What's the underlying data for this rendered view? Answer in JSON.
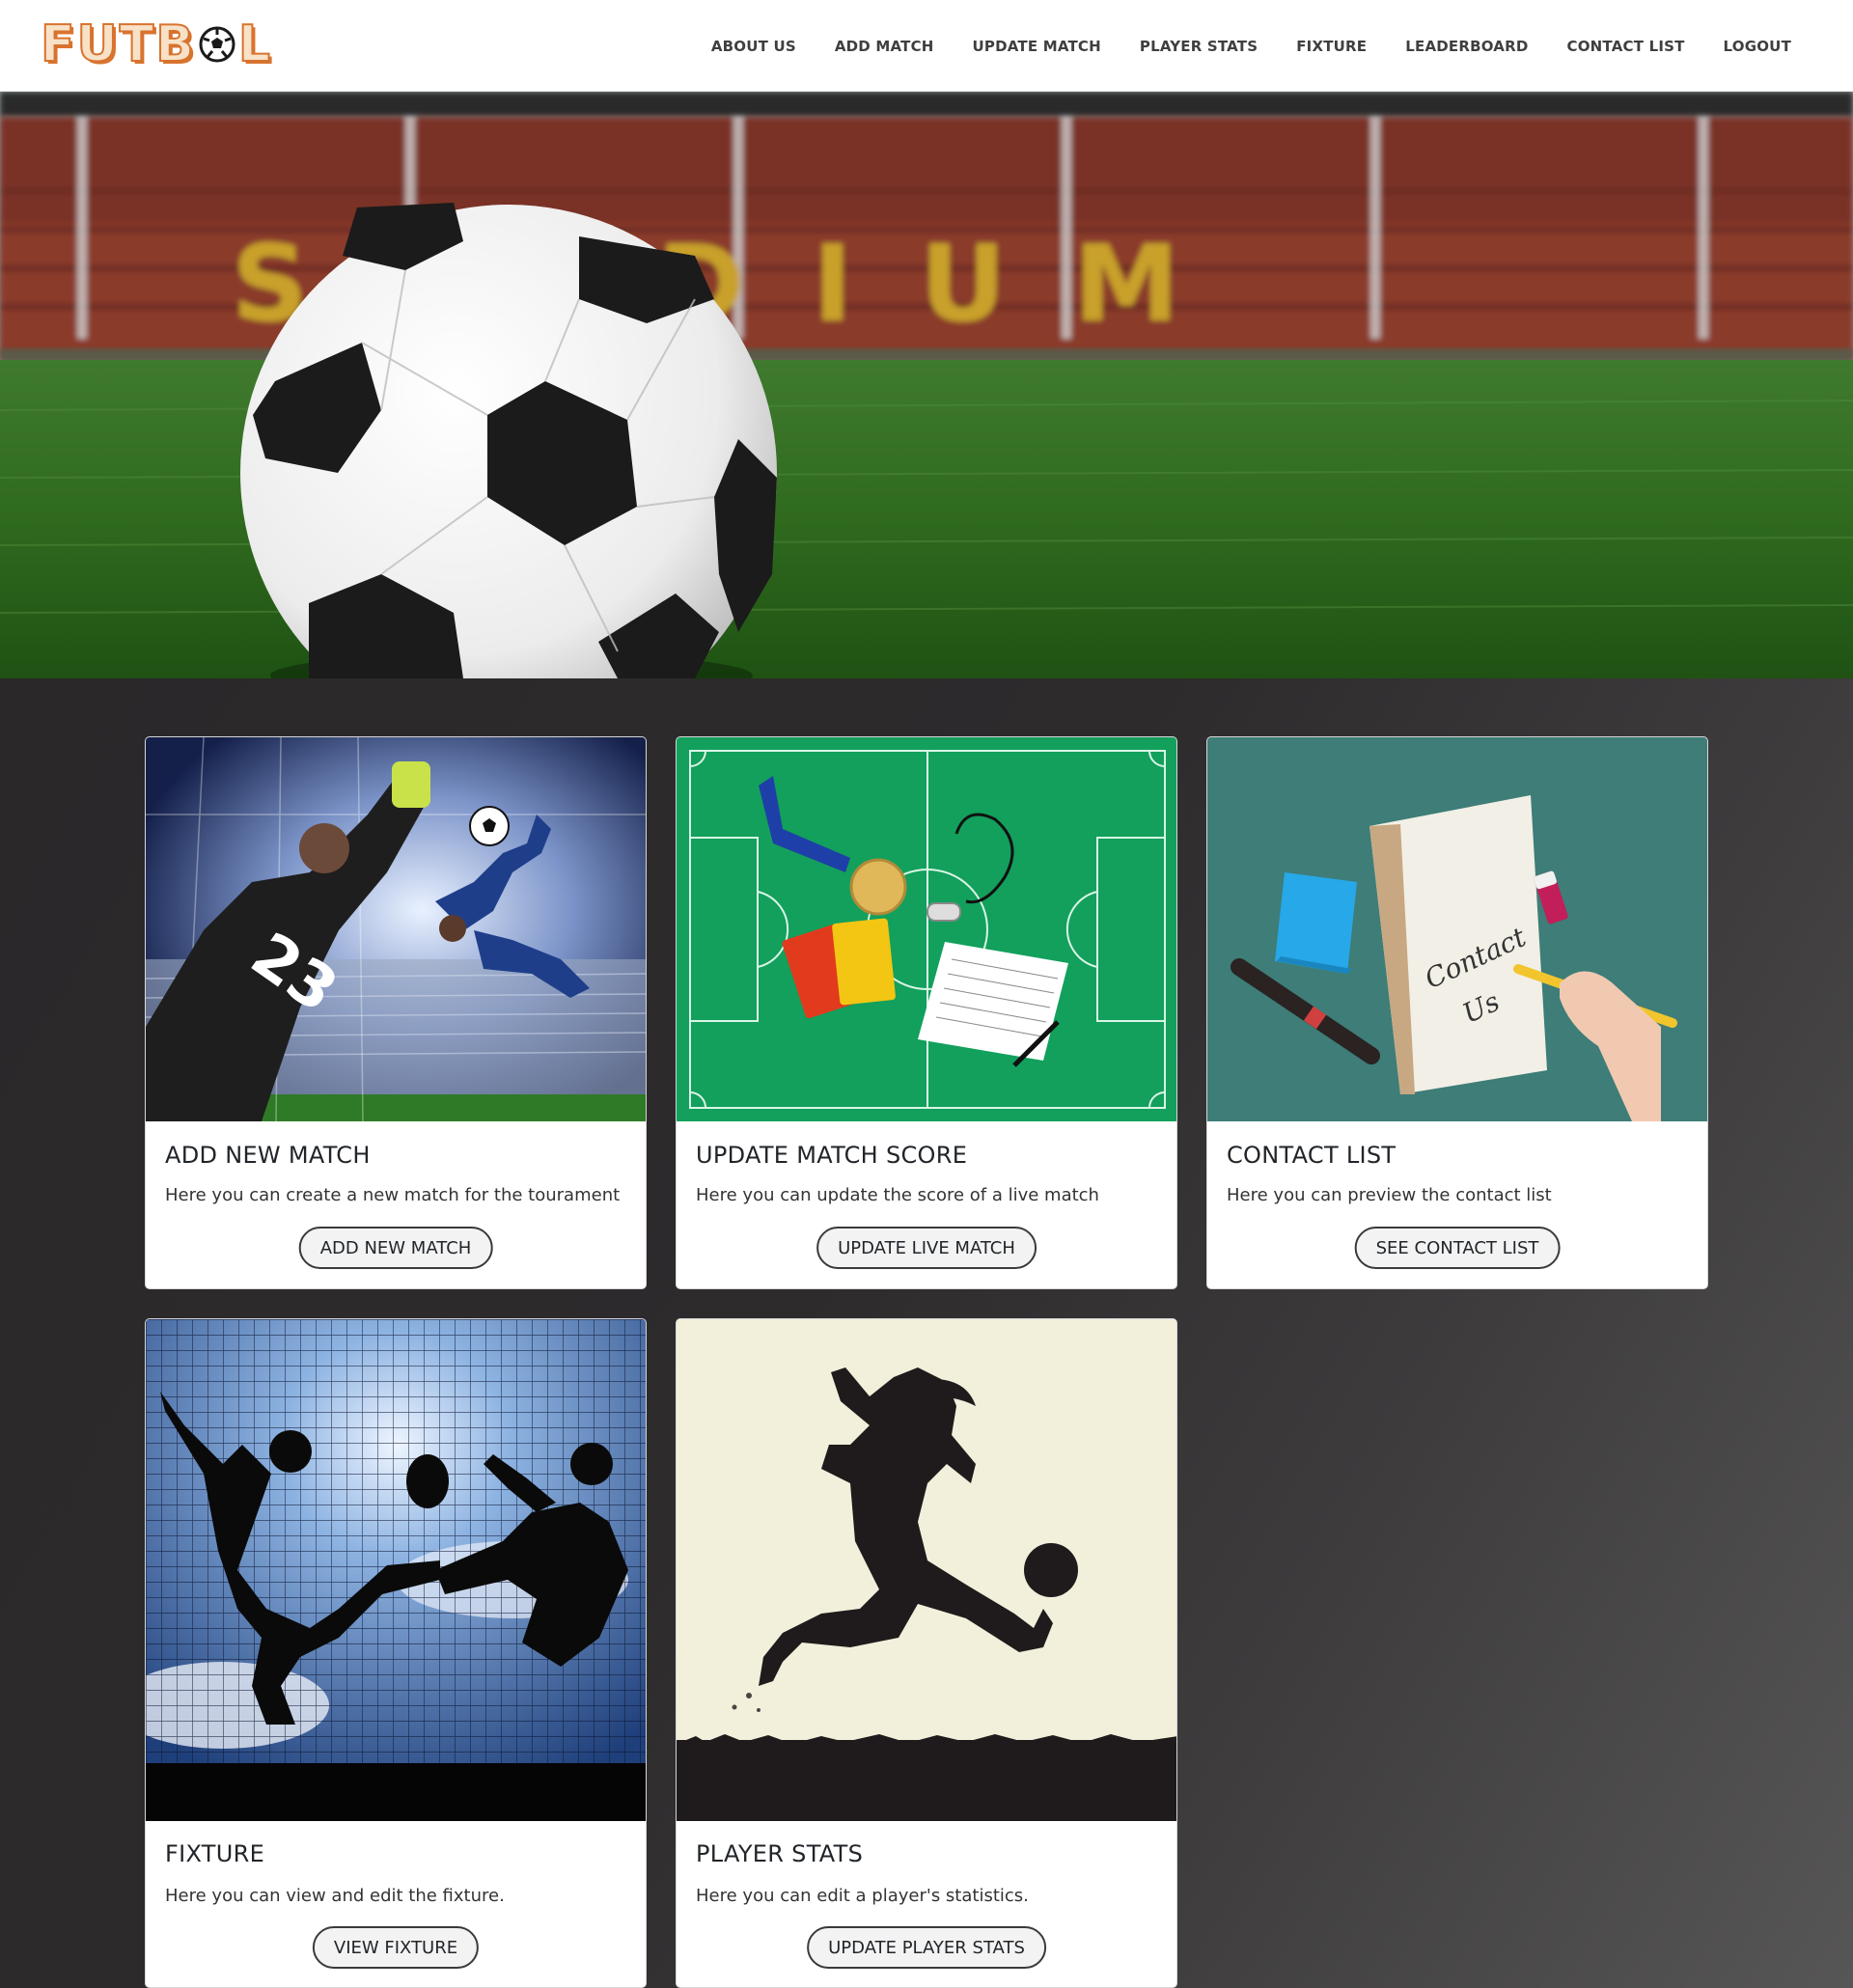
{
  "brand": {
    "logo_text_left": "FUTB",
    "logo_text_right": "L"
  },
  "nav": {
    "items": [
      {
        "label": "ABOUT US"
      },
      {
        "label": "ADD MATCH"
      },
      {
        "label": "UPDATE MATCH"
      },
      {
        "label": "PLAYER STATS"
      },
      {
        "label": "FIXTURE"
      },
      {
        "label": "LEADERBOARD"
      },
      {
        "label": "CONTACT LIST"
      },
      {
        "label": "LOGOUT"
      }
    ]
  },
  "hero": {
    "stadium_lettering": "STADIUM"
  },
  "cards": [
    {
      "title": "ADD NEW MATCH",
      "text": "Here you can create a new match for the tourament",
      "button": "ADD NEW MATCH",
      "jersey_number": "23"
    },
    {
      "title": "UPDATE MATCH SCORE",
      "text": "Here you can update the score of a live match",
      "button": "UPDATE LIVE MATCH"
    },
    {
      "title": "CONTACT LIST",
      "text": "Here you can preview the contact list",
      "button": "SEE CONTACT LIST",
      "note_line1": "Contact",
      "note_line2": "Us"
    },
    {
      "title": "FIXTURE",
      "text": "Here you can view and edit the fixture.",
      "button": "VIEW FIXTURE"
    },
    {
      "title": "PLAYER STATS",
      "text": "Here you can edit a player's statistics.",
      "button": "UPDATE PLAYER STATS"
    }
  ],
  "colors": {
    "accent_orange": "#d8732e",
    "nav_text": "#3f3f3f",
    "pitch_green": "#12a05c",
    "teal": "#3e7d78"
  }
}
